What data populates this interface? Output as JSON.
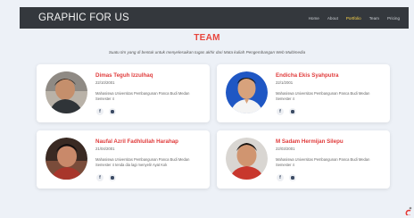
{
  "header": {
    "brand": "GRAPHIC FOR US",
    "nav": [
      "Home",
      "About",
      "Portfolio",
      "Team",
      "Pricing"
    ],
    "active": "Portfolio"
  },
  "team": {
    "title": "TEAM",
    "subtitle": "Suatu tim yang di bentuk untuk menyelesaikan tugas akhir dari Mata kuliah Pengembangan Web Multimedia"
  },
  "members": [
    {
      "name": "Dimas Teguh Izzulhaq",
      "dob": "22/10/2001",
      "desc": "Mahasiswa Universitas Pembangunan Panca Budi Medan Semester 4"
    },
    {
      "name": "Endicha Ekis Syahputra",
      "dob": "22/1/2001",
      "desc": "Mahasiswa Universitas Pembangunan Panca Budi Medan Semester 4"
    },
    {
      "name": "Naufal Azril Fadhlullah Harahap",
      "dob": "21/04/2001",
      "desc": "Mahasiswa Universitas Pembangunan Panca Budi Medan Semester 4 tenda dia lagi menyelir Ayat Kok"
    },
    {
      "name": "M Sadam Hermijan Silepu",
      "dob": "22/03/2001",
      "desc": "Mahasiswa Universitas Pembangunan Panca Budi Medan Semester 4"
    }
  ],
  "colors": {
    "navbar": "#34383d",
    "accent": "#e8453c",
    "active_link": "#ffd84a",
    "page_bg": "#edf1f7"
  }
}
